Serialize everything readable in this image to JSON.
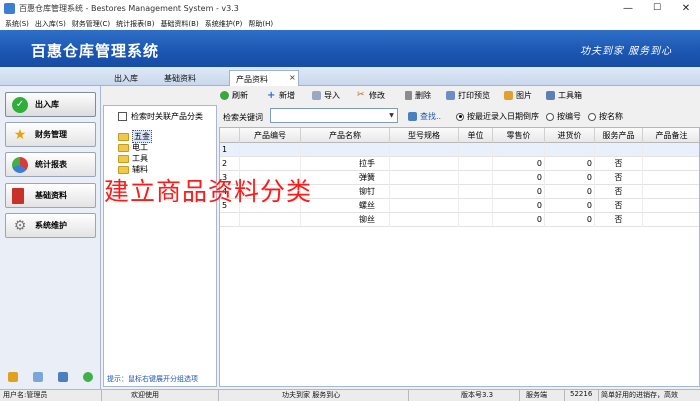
{
  "window": {
    "title": "百惠仓库管理系统 - Bestores Management System - v3.3",
    "minimize": "—",
    "maximize": "☐",
    "close": "✕"
  },
  "menu": [
    "系统(S)",
    "出入库(S)",
    "财务管理(C)",
    "统计报表(B)",
    "基础资料(B)",
    "系统维护(P)",
    "帮助(H)"
  ],
  "banner": {
    "title": "百惠仓库管理系统",
    "slogan": "功夫到家 服务到心"
  },
  "tabs": [
    {
      "label": "出入库"
    },
    {
      "label": "基础资料"
    },
    {
      "label": "产品资料",
      "close": "×"
    }
  ],
  "nav": [
    {
      "label": "出入库"
    },
    {
      "label": "财务管理"
    },
    {
      "label": "统计报表"
    },
    {
      "label": "基础资料"
    },
    {
      "label": "系统维护"
    }
  ],
  "tree": {
    "check_label": "检索时关联产品分类",
    "nodes": [
      "五金",
      "电工",
      "工具",
      "辅料"
    ],
    "hint": "提示：鼠标右键展开分组选项"
  },
  "toolbar": [
    "刷新",
    "新增",
    "导入",
    "修改",
    "删除",
    "打印预览",
    "图片",
    "工具箱"
  ],
  "search": {
    "label": "检索关键词",
    "value": "",
    "dropdown": "▼",
    "button": "查找..",
    "options": [
      {
        "label": "按最近录入日期倒序",
        "selected": true
      },
      {
        "label": "按编号",
        "selected": false
      },
      {
        "label": "按名称",
        "selected": false
      }
    ]
  },
  "grid": {
    "columns": [
      "产品编号",
      "产品名称",
      "型号规格",
      "单位",
      "零售价",
      "进货价",
      "服务产品",
      "产品备注"
    ],
    "rows": [
      {
        "idx": "1",
        "code": "",
        "name": "",
        "spec": "",
        "unit": "",
        "retail": "",
        "cost": "",
        "service": "",
        "note": ""
      },
      {
        "idx": "2",
        "code": "",
        "name": "拉手",
        "spec": "",
        "unit": "",
        "retail": "0",
        "cost": "0",
        "service": "否",
        "note": ""
      },
      {
        "idx": "3",
        "code": "",
        "name": "弹簧",
        "spec": "",
        "unit": "",
        "retail": "0",
        "cost": "0",
        "service": "否",
        "note": ""
      },
      {
        "idx": "4",
        "code": "",
        "name": "铆钉",
        "spec": "",
        "unit": "",
        "retail": "0",
        "cost": "0",
        "service": "否",
        "note": ""
      },
      {
        "idx": "5",
        "code": "",
        "name": "螺丝",
        "spec": "",
        "unit": "",
        "retail": "0",
        "cost": "0",
        "service": "否",
        "note": ""
      },
      {
        "idx": "",
        "code": "",
        "name": "铆丝",
        "spec": "",
        "unit": "",
        "retail": "0",
        "cost": "0",
        "service": "否",
        "note": ""
      }
    ]
  },
  "overlay_text": "建立商品资料分类",
  "status": {
    "user": "用户名:管理员",
    "welcome": "欢迎使用",
    "motto": "功夫到家 服务到心",
    "version": "版本号3.3",
    "port_label": "服务端",
    "port": "52216",
    "tagline": "简单好用的进销存，高效"
  },
  "colors": {
    "banner": "#1b56b2",
    "overlay": "#ff1a1a",
    "folder": "#f0c84a"
  }
}
